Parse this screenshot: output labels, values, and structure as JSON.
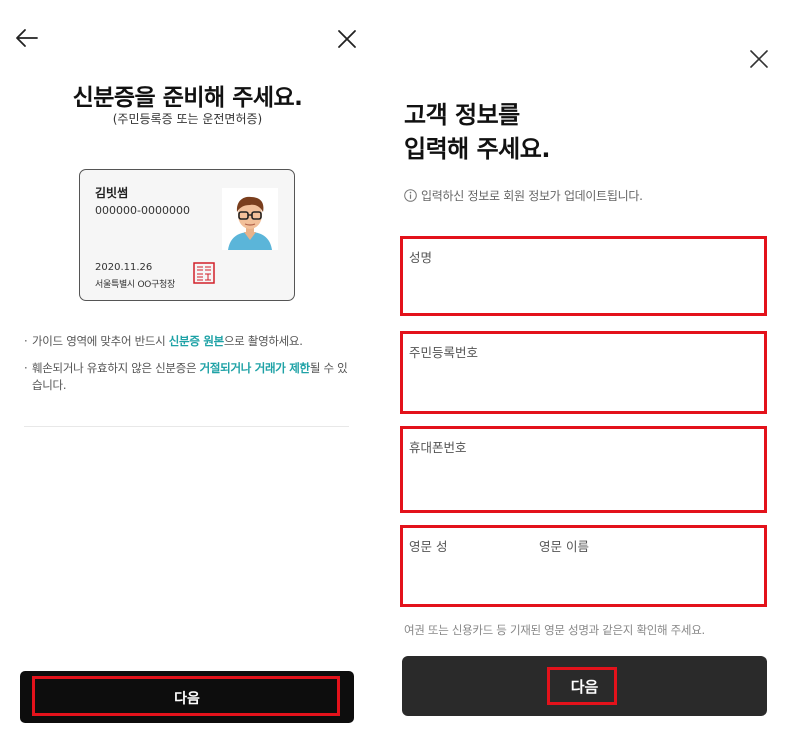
{
  "left": {
    "title": "신분증을 준비해 주세요.",
    "subtitle": "(주민등록증 또는 운전면허증)",
    "card": {
      "name": "김빗썸",
      "rrn": "000000-0000000",
      "date": "2020.11.26",
      "issuer": "서울특별시 OO구청장"
    },
    "bullet_dot": "·",
    "bullet1": {
      "pre": "가이드 영역에 맞추어 반드시 ",
      "highlight": "신분증 원본",
      "post": "으로 촬영하세요."
    },
    "bullet2": {
      "pre": "훼손되거나 유효하지 않은 신분증은 ",
      "highlight": "거절되거나 거래가 제한",
      "post": "될 수 있습니다."
    },
    "next_label": "다음"
  },
  "right": {
    "title_line1": "고객 정보를",
    "title_line2": "입력해 주세요.",
    "info": "입력하신 정보로 회원 정보가 업데이트됩니다.",
    "fields": {
      "name_label": "성명",
      "rrn_label": "주민등록번호",
      "phone_label": "휴대폰번호",
      "eng_last_label": "영문 성",
      "eng_first_label": "영문 이름"
    },
    "note": "여권 또는 신용카드 등 기재된 영문 성명과 같은지 확인해 주세요.",
    "next_label": "다음"
  },
  "colors": {
    "accent": "#1ea2a6",
    "highlight_box": "#e3121b",
    "button_dark_left": "#0d0d0d",
    "button_dark_right": "#2a2a2a"
  },
  "icons": [
    "back-arrow-icon",
    "close-icon",
    "info-circle-icon",
    "avatar-photo",
    "official-seal-icon"
  ]
}
